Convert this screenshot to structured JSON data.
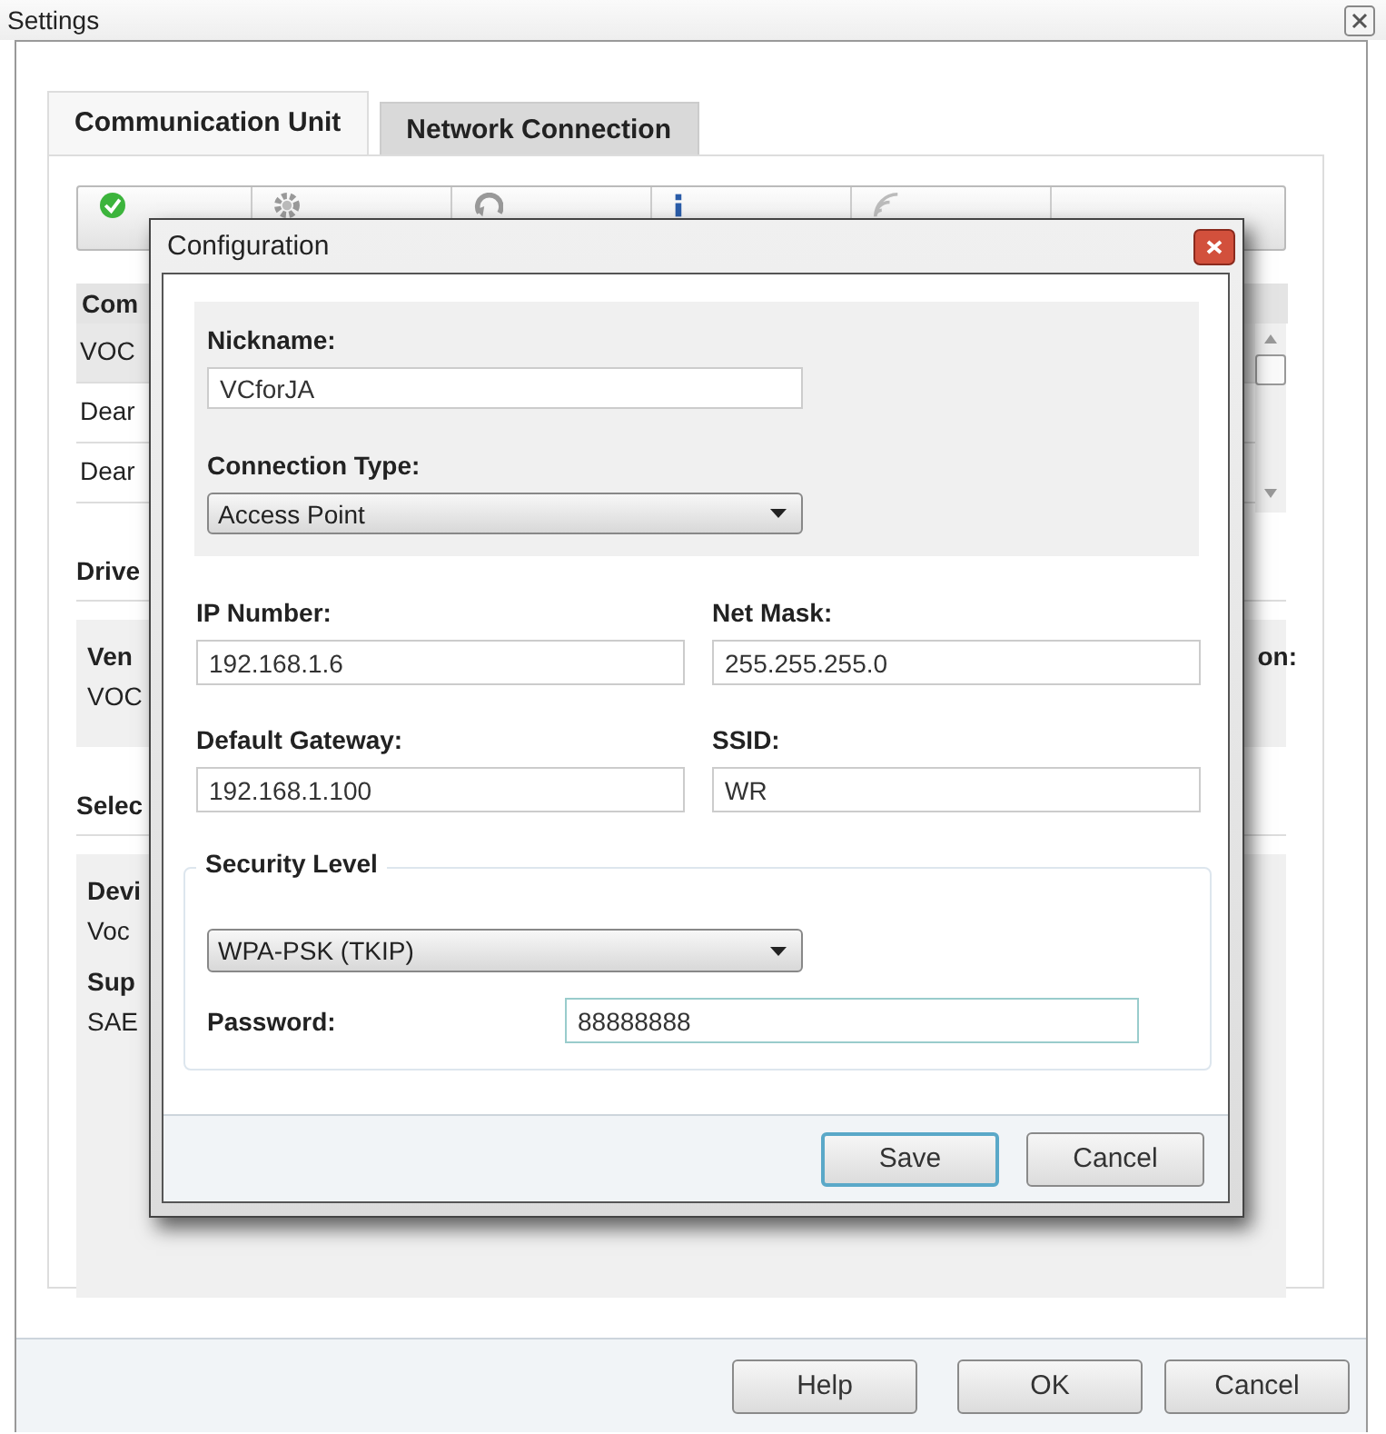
{
  "window": {
    "title": "Settings"
  },
  "tabs": [
    {
      "label": "Communication Unit",
      "selected": true
    },
    {
      "label": "Network Connection",
      "selected": false
    }
  ],
  "unit_list": {
    "column_1": "Com",
    "rows": [
      {
        "cell": "VOC",
        "selected": true
      },
      {
        "cell": "Dear",
        "selected": false
      },
      {
        "cell": "Dear",
        "selected": false
      }
    ]
  },
  "driver_section": {
    "title": "Drive",
    "field_label": "Ven",
    "field_value": "VOC",
    "right_label": "on:"
  },
  "selected_section": {
    "title": "Selec",
    "fields": [
      {
        "label": "Devi",
        "value": "Voc"
      },
      {
        "label": "Sup",
        "value": "SAE"
      }
    ]
  },
  "dialog": {
    "title": "Configuration",
    "nickname": {
      "label": "Nickname:",
      "value": "VCforJA"
    },
    "connection_type": {
      "label": "Connection Type:",
      "value": "Access Point"
    },
    "ip_number": {
      "label": "IP Number:",
      "value": "192.168.1.6"
    },
    "net_mask": {
      "label": "Net Mask:",
      "value": "255.255.255.0"
    },
    "default_gateway": {
      "label": "Default Gateway:",
      "value": "192.168.1.100"
    },
    "ssid": {
      "label": "SSID:",
      "value": "WR"
    },
    "security": {
      "legend": "Security Level",
      "level": "WPA-PSK (TKIP)",
      "password_label": "Password:",
      "password": "88888888"
    },
    "buttons": [
      {
        "label": "Save",
        "default": true
      },
      {
        "label": "Cancel",
        "default": false
      }
    ]
  },
  "buttons": [
    "Help",
    "OK",
    "Cancel"
  ]
}
